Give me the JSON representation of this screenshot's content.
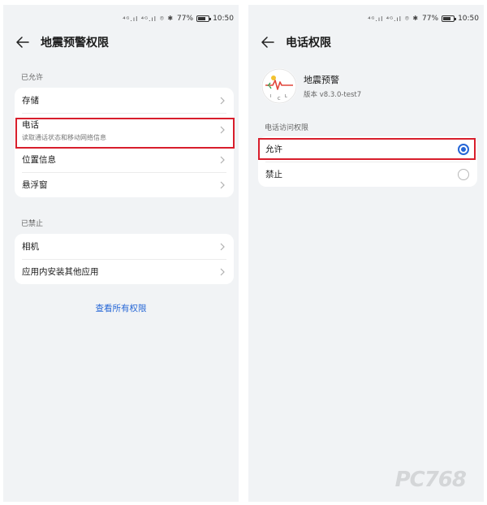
{
  "left": {
    "status_bar": {
      "signal": "⁴ᴳ.ıl ⁴ᴳ.ıl",
      "battery_percent": "77%",
      "time": "10:50"
    },
    "title": "地震预警权限",
    "allowed_label": "已允许",
    "allowed_items": [
      {
        "title": "存储"
      },
      {
        "title": "电话",
        "subtitle": "读取通话状态和移动网络信息"
      },
      {
        "title": "位置信息"
      },
      {
        "title": "悬浮窗"
      }
    ],
    "denied_label": "已禁止",
    "denied_items": [
      {
        "title": "相机"
      },
      {
        "title": "应用内安装其他应用"
      }
    ],
    "view_all_link": "查看所有权限"
  },
  "right": {
    "status_bar": {
      "signal": "⁴ᴳ.ıl ⁴ᴳ.ıl",
      "battery_percent": "77%",
      "time": "10:50"
    },
    "title": "电话权限",
    "app_name": "地震预警",
    "app_version": "版本 v8.3.0-test7",
    "section_label": "电话访问权限",
    "options": [
      {
        "label": "允许",
        "selected": true
      },
      {
        "label": "禁止",
        "selected": false
      }
    ]
  },
  "battery_level": 0.77,
  "colors": {
    "accent": "#2566d6",
    "highlight": "#d81e2c",
    "background": "#f1f3f5"
  },
  "watermark": "PC768"
}
